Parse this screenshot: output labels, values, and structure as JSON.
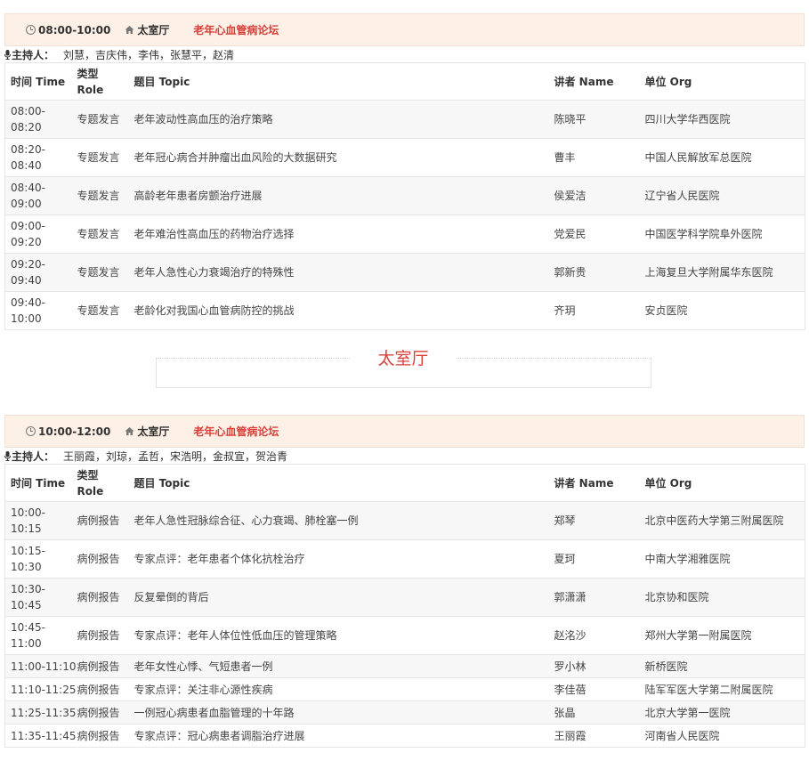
{
  "sessions": [
    {
      "time": "08:00-10:00",
      "room": "太室厅",
      "forum": "老年心血管病论坛",
      "hosts_label": "主持人：",
      "hosts": "刘慧，吉庆伟，李伟，张慧平，赵清",
      "headers": {
        "time": "时间 Time",
        "role": "类型 Role",
        "topic": "题目 Topic",
        "speaker": "讲者 Name",
        "org": "单位 Org"
      },
      "rows": [
        {
          "time": "08:00-08:20",
          "role": "专题发言",
          "topic": "老年波动性高血压的治疗策略",
          "speaker": "陈晓平",
          "org": "四川大学华西医院"
        },
        {
          "time": "08:20-08:40",
          "role": "专题发言",
          "topic": "老年冠心病合并肿瘤出血风险的大数据研究",
          "speaker": "曹丰",
          "org": "中国人民解放军总医院"
        },
        {
          "time": "08:40-09:00",
          "role": "专题发言",
          "topic": "高龄老年患者房颤治疗进展",
          "speaker": "侯爱洁",
          "org": "辽宁省人民医院"
        },
        {
          "time": "09:00-09:20",
          "role": "专题发言",
          "topic": "老年难治性高血压的药物治疗选择",
          "speaker": "党爱民",
          "org": "中国医学科学院阜外医院"
        },
        {
          "time": "09:20-09:40",
          "role": "专题发言",
          "topic": "老年人急性心力衰竭治疗的特殊性",
          "speaker": "郭新贵",
          "org": "上海复旦大学附属华东医院"
        },
        {
          "time": "09:40-10:00",
          "role": "专题发言",
          "topic": "老龄化对我国心血管病防控的挑战",
          "speaker": "齐玥",
          "org": "安贞医院"
        }
      ]
    },
    {
      "time": "10:00-12:00",
      "room": "太室厅",
      "forum": "老年心血管病论坛",
      "hosts_label": "主持人：",
      "hosts": "王丽霞，刘琼，孟哲，宋浩明，金叔宣，贺治青",
      "headers": {
        "time": "时间 Time",
        "role": "类型 Role",
        "topic": "题目 Topic",
        "speaker": "讲者 Name",
        "org": "单位 Org"
      },
      "rows": [
        {
          "time": "10:00-10:15",
          "role": "病例报告",
          "topic": "老年人急性冠脉综合征、心力衰竭、肺栓塞一例",
          "speaker": "郑琴",
          "org": "北京中医药大学第三附属医院"
        },
        {
          "time": "10:15-10:30",
          "role": "病例报告",
          "topic": "专家点评：老年患者个体化抗栓治疗",
          "speaker": "夏珂",
          "org": "中南大学湘雅医院"
        },
        {
          "time": "10:30-10:45",
          "role": "病例报告",
          "topic": "反复晕倒的背后",
          "speaker": "郭潇潇",
          "org": "北京协和医院"
        },
        {
          "time": "10:45-11:00",
          "role": "病例报告",
          "topic": "专家点评：老年人体位性低血压的管理策略",
          "speaker": "赵洺沙",
          "org": "郑州大学第一附属医院"
        },
        {
          "time": "11:00-11:10",
          "role": "病例报告",
          "topic": "老年女性心悸、气短患者一例",
          "speaker": "罗小林",
          "org": "新桥医院"
        },
        {
          "time": "11:10-11:25",
          "role": "病例报告",
          "topic": "专家点评：关注非心源性疾病",
          "speaker": "李佳蓓",
          "org": "陆军军医大学第二附属医院"
        },
        {
          "time": "11:25-11:35",
          "role": "病例报告",
          "topic": "一例冠心病患者血脂管理的十年路",
          "speaker": "张晶",
          "org": "北京大学第一医院"
        },
        {
          "time": "11:35-11:45",
          "role": "病例报告",
          "topic": "专家点评：冠心病患者调脂治疗进展",
          "speaker": "王丽霞",
          "org": "河南省人民医院"
        }
      ]
    }
  ],
  "divider": {
    "title": "太室厅"
  },
  "icons": {
    "clock": "clock-icon",
    "home": "home-icon",
    "mic": "microphone-icon"
  },
  "colors": {
    "forum": "#d9403a",
    "header_bg": "#fdf0e6",
    "alt_row": "#f7f7f7",
    "divider_title": "#d9403a"
  }
}
